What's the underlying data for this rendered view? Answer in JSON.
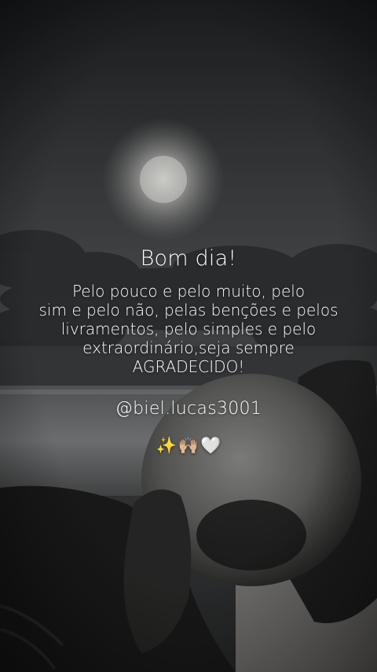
{
  "post": {
    "title": "Bom dia!",
    "message_lines": [
      "Pelo pouco e pelo muito, pelo",
      "sim e pelo não, pelas benções e pelos",
      "livramentos, pelo simples e pelo",
      "extraordinário,seja sempre",
      "AGRADECIDO!"
    ],
    "handle": "@biel.lucas3001",
    "emojis": [
      "✨",
      "🙌🏼",
      "🤍"
    ]
  },
  "colors": {
    "text": "#ffffff",
    "sky_top": "#1f2124",
    "sky_mid": "#4a4c4e",
    "sea": "#6e7072",
    "sand": "#8a8886"
  }
}
